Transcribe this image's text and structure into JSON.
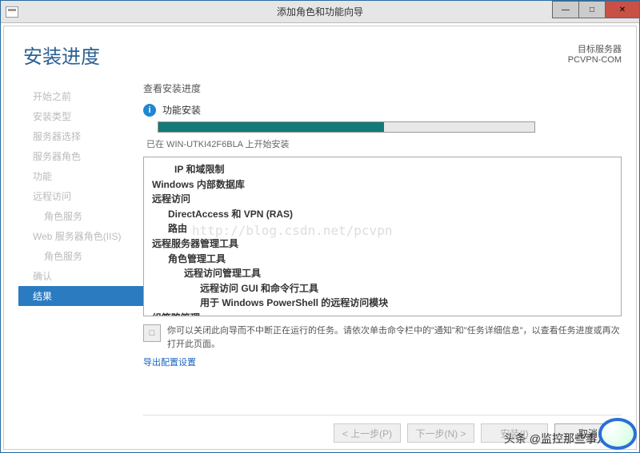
{
  "titlebar": {
    "title": "添加角色和功能向导"
  },
  "header": {
    "page_title": "安装进度",
    "dest_label": "目标服务器",
    "dest_name": "PCVPN-COM"
  },
  "sidebar": {
    "items": [
      {
        "label": "开始之前",
        "sub": false,
        "active": false
      },
      {
        "label": "安装类型",
        "sub": false,
        "active": false
      },
      {
        "label": "服务器选择",
        "sub": false,
        "active": false
      },
      {
        "label": "服务器角色",
        "sub": false,
        "active": false
      },
      {
        "label": "功能",
        "sub": false,
        "active": false
      },
      {
        "label": "远程访问",
        "sub": false,
        "active": false
      },
      {
        "label": "角色服务",
        "sub": true,
        "active": false
      },
      {
        "label": "Web 服务器角色(IIS)",
        "sub": false,
        "active": false
      },
      {
        "label": "角色服务",
        "sub": true,
        "active": false
      },
      {
        "label": "确认",
        "sub": false,
        "active": false
      },
      {
        "label": "结果",
        "sub": false,
        "active": true
      }
    ]
  },
  "main": {
    "section_label": "查看安装进度",
    "status_text": "功能安装",
    "progress_percent": 60,
    "status_note": "已在 WIN-UTKI42F6BLA 上开始安装",
    "tree": [
      {
        "lvl": 1,
        "text": "IP 和域限制"
      },
      {
        "lvl": 0,
        "text": "Windows 内部数据库"
      },
      {
        "lvl": 0,
        "text": "远程访问"
      },
      {
        "lvl": 2,
        "text": "DirectAccess 和 VPN (RAS)"
      },
      {
        "lvl": 2,
        "text": "路由"
      },
      {
        "lvl": 0,
        "text": "远程服务器管理工具"
      },
      {
        "lvl": 2,
        "text": "角色管理工具"
      },
      {
        "lvl": 3,
        "text": "远程访问管理工具"
      },
      {
        "lvl": 4,
        "text": "远程访问 GUI 和命令行工具"
      },
      {
        "lvl": 4,
        "text": "用于 Windows PowerShell 的远程访问模块"
      },
      {
        "lvl": 0,
        "text": "组策略管理"
      }
    ],
    "watermark": "http://blog.csdn.net/pcvpn",
    "note_text": "你可以关闭此向导而不中断正在运行的任务。请依次单击命令栏中的\"通知\"和\"任务详细信息\"，以查看任务进度或再次打开此页面。",
    "export_link": "导出配置设置"
  },
  "footer": {
    "prev": "< 上一步(P)",
    "next": "下一步(N) >",
    "install": "安装(I)",
    "cancel": "取消"
  },
  "overlay": {
    "text": "头条 @监控那些事儿"
  }
}
